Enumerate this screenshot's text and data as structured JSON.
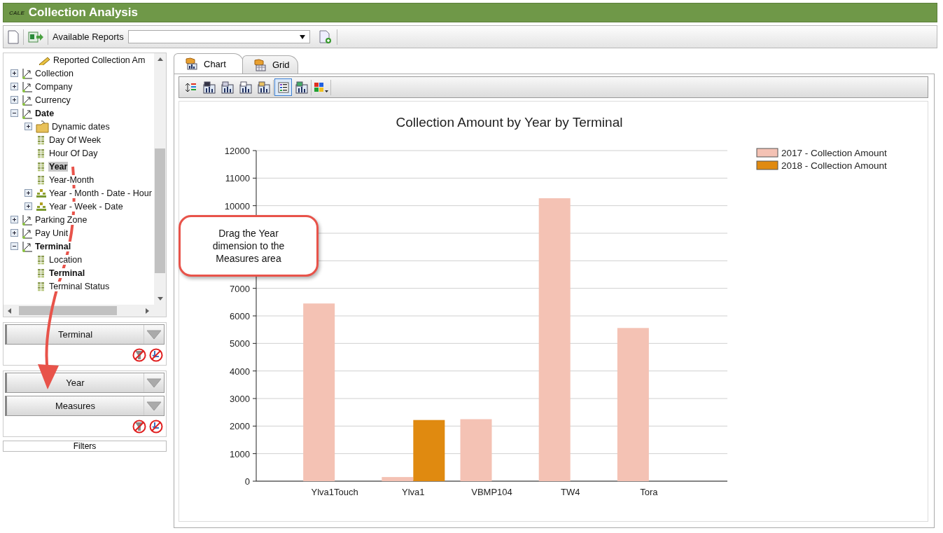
{
  "window": {
    "title": "Collection Analysis",
    "logo": "CALE"
  },
  "toolbar": {
    "reports_label": "Available Reports"
  },
  "tree": {
    "top_partial_item": {
      "label": "Reported Collection Am",
      "kind": "measure"
    },
    "items": [
      {
        "label": "Collection",
        "kind": "dimension",
        "expanded": false,
        "bold": false,
        "selected": false
      },
      {
        "label": "Company",
        "kind": "dimension",
        "expanded": false,
        "bold": false,
        "selected": false
      },
      {
        "label": "Currency",
        "kind": "dimension",
        "expanded": false,
        "bold": false,
        "selected": false
      },
      {
        "label": "Date",
        "kind": "dimension",
        "expanded": true,
        "bold": true,
        "selected": false,
        "children": [
          {
            "label": "Dynamic dates",
            "kind": "folder",
            "expanded": false,
            "bold": false,
            "selected": false
          },
          {
            "label": "Day Of Week",
            "kind": "attribute",
            "bold": false,
            "selected": false
          },
          {
            "label": "Hour Of Day",
            "kind": "attribute",
            "bold": false,
            "selected": false
          },
          {
            "label": "Year",
            "kind": "attribute",
            "bold": true,
            "selected": true
          },
          {
            "label": "Year-Month",
            "kind": "attribute",
            "bold": false,
            "selected": false
          },
          {
            "label": "Year - Month - Date - Hour",
            "kind": "hierarchy",
            "expanded": false,
            "bold": false,
            "selected": false
          },
          {
            "label": "Year - Week - Date",
            "kind": "hierarchy",
            "expanded": false,
            "bold": false,
            "selected": false
          }
        ]
      },
      {
        "label": "Parking Zone",
        "kind": "dimension",
        "expanded": false,
        "bold": false,
        "selected": false
      },
      {
        "label": "Pay Unit",
        "kind": "dimension",
        "expanded": false,
        "bold": false,
        "selected": false
      },
      {
        "label": "Terminal",
        "kind": "dimension",
        "expanded": true,
        "bold": true,
        "selected": false,
        "children": [
          {
            "label": "Location",
            "kind": "attribute",
            "bold": false,
            "selected": false
          },
          {
            "label": "Terminal",
            "kind": "attribute",
            "bold": true,
            "selected": false
          },
          {
            "label": "Terminal Status",
            "kind": "attribute",
            "bold": false,
            "selected": false
          }
        ]
      }
    ]
  },
  "pivot_areas": [
    {
      "fields": [
        "Terminal"
      ]
    },
    {
      "fields": [
        "Year",
        "Measures"
      ]
    }
  ],
  "filters_label": "Filters",
  "tabs": [
    {
      "label": "Chart",
      "selected": true
    },
    {
      "label": "Grid",
      "selected": false
    }
  ],
  "chart_toolbar": [
    {
      "selected": false
    },
    {
      "selected": false
    },
    {
      "selected": false
    },
    {
      "selected": false
    },
    {
      "selected": false
    },
    {
      "selected": true
    },
    {
      "selected": false
    },
    {
      "selected": false
    }
  ],
  "chart": {
    "chart_data": {
      "type": "bar",
      "title": "Collection Amount by Year by Terminal",
      "categories": [
        "Ylva1Touch",
        "Ylva1",
        "VBMP104",
        "TW4",
        "Tora"
      ],
      "series": [
        {
          "name": "2017 - Collection Amount",
          "color": "#f4c2b4",
          "values": [
            6450,
            150,
            2250,
            10270,
            5560
          ]
        },
        {
          "name": "2018 - Collection Amount",
          "color": "#e08a10",
          "values": [
            null,
            2220,
            null,
            null,
            null
          ]
        }
      ],
      "grid": true,
      "legend": true,
      "ylim": [
        0,
        12000
      ],
      "yticks": [
        0,
        1000,
        2000,
        3000,
        4000,
        5000,
        6000,
        7000,
        10000,
        11000,
        12000
      ]
    }
  },
  "callout": {
    "text": "Drag the Year dimension to the Measures area"
  }
}
